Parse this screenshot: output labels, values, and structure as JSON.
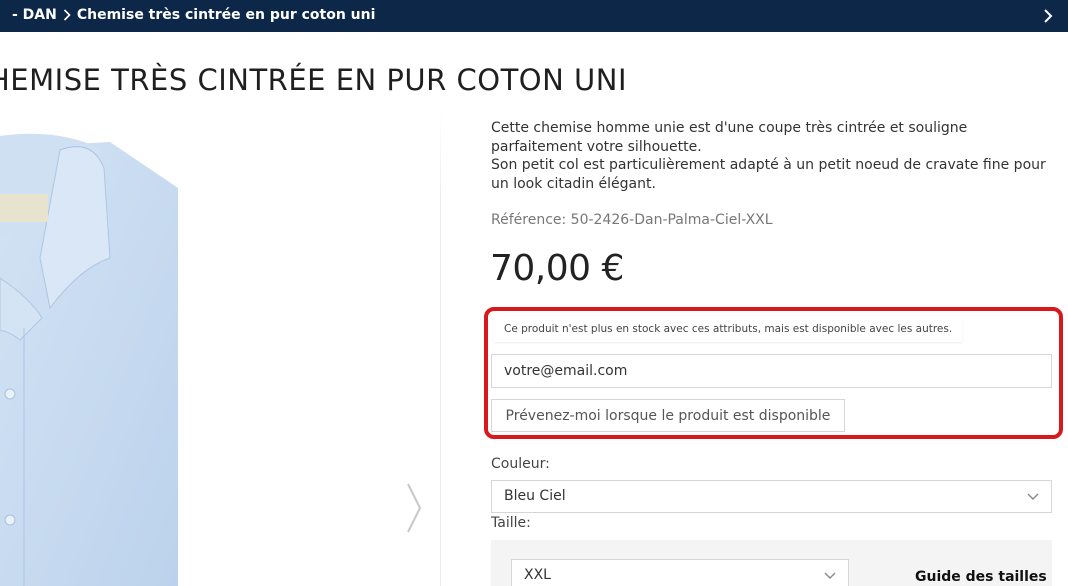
{
  "breadcrumb": {
    "parent": "- DAN",
    "current": "Chemise très cintrée en pur coton uni"
  },
  "product": {
    "title": "HEMISE TRÈS CINTRÉE EN PUR COTON UNI",
    "description_line1": "Cette chemise homme unie est d'une coupe très cintrée et souligne parfaitement votre silhouette.",
    "description_line2": "Son petit col est particulièrement adapté à un petit noeud de cravate fine pour un look citadin élégant.",
    "reference": "Référence: 50-2426-Dan-Palma-Ciel-XXL",
    "price": "70,00 €"
  },
  "stock_alert": {
    "message": "Ce produit n'est plus en stock avec ces attributs, mais est disponible avec les autres.",
    "email_value": "votre@email.com",
    "button_label": "Prévenez-moi lorsque le produit est disponible",
    "highlight_color": "#d7191b"
  },
  "options": {
    "color_label": "Couleur:",
    "color_value": "Bleu Ciel",
    "size_label": "Taille:",
    "size_value": "XXL",
    "size_guide": "Guide des tailles"
  },
  "theme": {
    "topbar_color": "#0d2748",
    "shirt_color": "#c9dcf1"
  },
  "icons": {
    "breadcrumb_separator": "chevron-right-icon",
    "topbar_next": "chevron-right-icon",
    "gallery_next": "chevron-right-icon",
    "select_caret": "chevron-down-icon"
  }
}
